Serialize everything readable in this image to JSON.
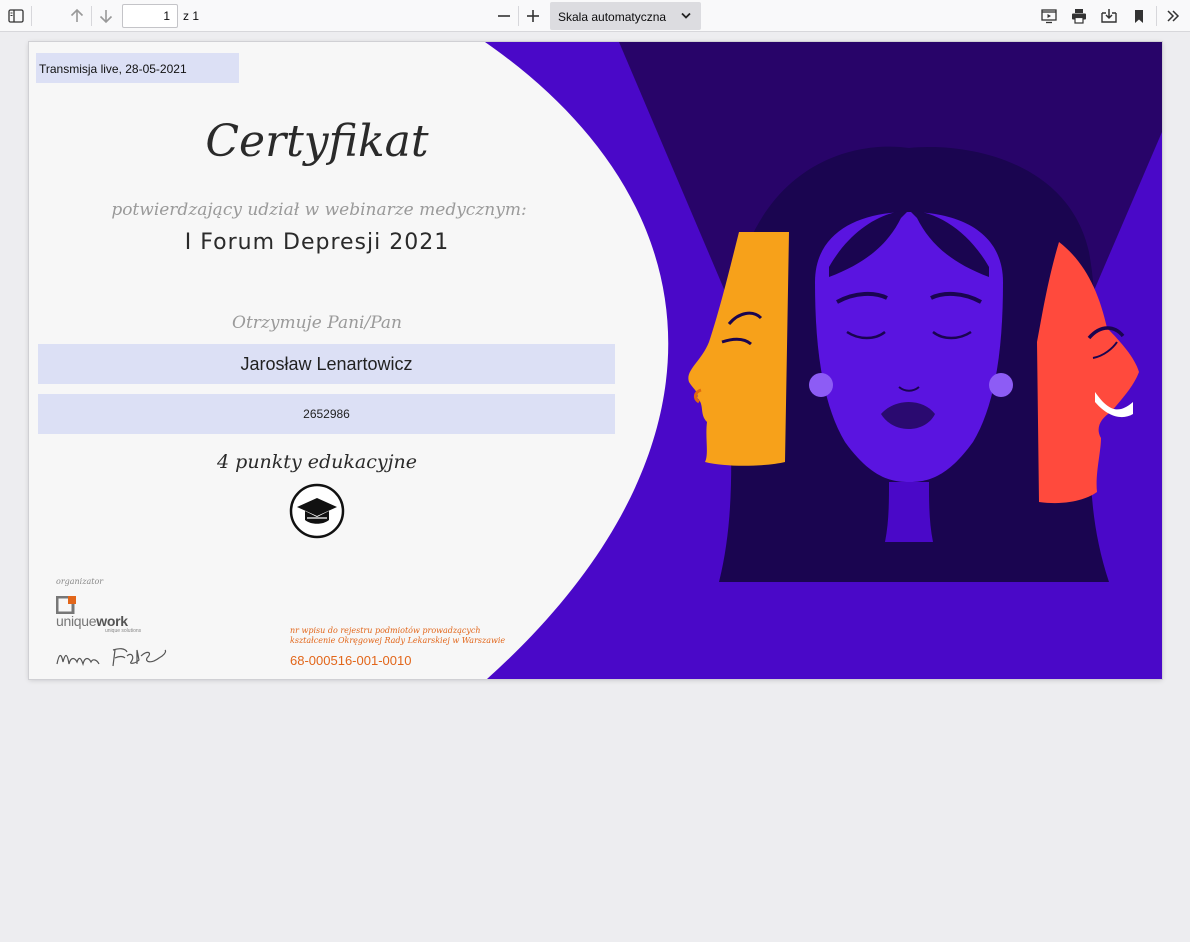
{
  "toolbar": {
    "page_number": "1",
    "page_count": "z 1",
    "scale": "Skala automatyczna",
    "icons": [
      "sidebar-icon",
      "arrow-up-icon",
      "arrow-down-icon",
      "zoom-out-icon",
      "zoom-in-icon",
      "presentation-icon",
      "print-icon",
      "save-icon",
      "bookmark-icon",
      "chevron-right-double-icon"
    ]
  },
  "certificate": {
    "date_field": "Transmisja live, 28-05-2021",
    "title": "Certyfikat",
    "subtitle": "potwierdzający udział w webinarze medycznym:",
    "event_name": "I Forum Depresji 2021",
    "receives_label": "Otrzymuje Pani/Pan",
    "recipient_name": "Jarosław  Lenartowicz",
    "recipient_id": "2652986",
    "points": "4 punkty edukacyjne",
    "organizer_label": "organizator",
    "organizer_logo": "uniquework",
    "organizer_logo_prefix": "unique",
    "organizer_logo_suffix": "work",
    "organizer_tagline": "unique solutions",
    "register_line1": "nr wpisu do rejestru podmiotów prowadzących",
    "register_line2": "kształcenie Okręgowej Rady Lekarskiej w Warszawie",
    "register_number": "68-000516-001-0010"
  },
  "colors": {
    "accent_purple": "#4a08c8",
    "dark_purple": "#25045e",
    "orange_face": "#f7a11a",
    "red_face": "#ff4a3d",
    "field_bg": "#dce0f5",
    "register_orange": "#e2661a"
  }
}
